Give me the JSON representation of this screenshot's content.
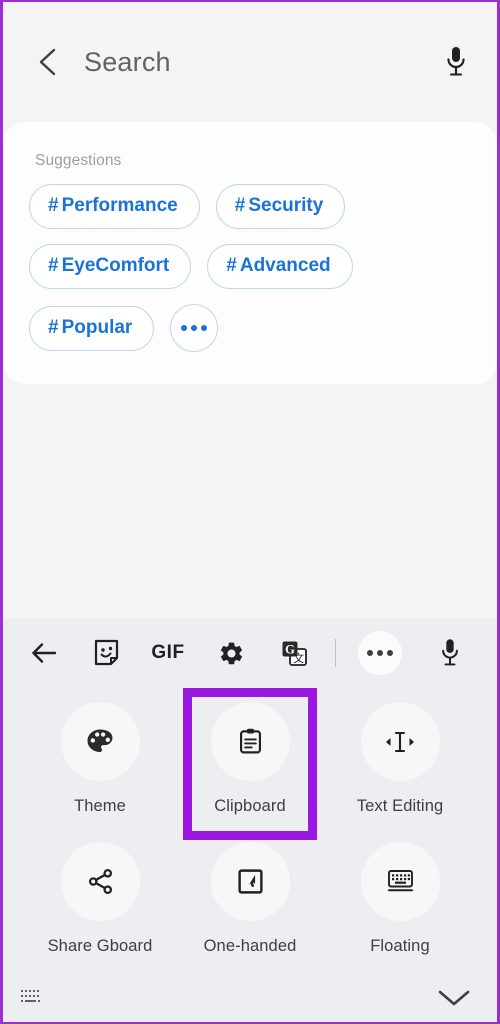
{
  "header": {
    "back_icon": "chevron-left-icon",
    "title": "Search",
    "mic_icon": "microphone-icon"
  },
  "suggestions": {
    "section_title": "Suggestions",
    "rows": [
      [
        {
          "hash": "#",
          "label": "Performance"
        },
        {
          "hash": "#",
          "label": "Security"
        }
      ],
      [
        {
          "hash": "#",
          "label": "EyeComfort"
        },
        {
          "hash": "#",
          "label": "Advanced"
        }
      ],
      [
        {
          "hash": "#",
          "label": "Popular"
        }
      ]
    ],
    "more_icon": "ellipsis-icon",
    "chip_text_color": "#1a73d8",
    "chip_border_color": "#bcd6f4"
  },
  "keyboard": {
    "toolbar": {
      "back_icon": "arrow-left-icon",
      "sticker_icon": "sticker-smiley-icon",
      "gif_label": "GIF",
      "settings_icon": "gear-icon",
      "translate_icon": "google-translate-icon",
      "more_icon": "ellipsis-icon",
      "mic_icon": "microphone-icon"
    },
    "grid": [
      {
        "icon": "palette-icon",
        "label": "Theme",
        "highlighted": false
      },
      {
        "icon": "clipboard-icon",
        "label": "Clipboard",
        "highlighted": true
      },
      {
        "icon": "text-cursor-icon",
        "label": "Text Editing",
        "highlighted": false
      },
      {
        "icon": "share-icon",
        "label": "Share Gboard",
        "highlighted": false
      },
      {
        "icon": "one-handed-icon",
        "label": "One-handed",
        "highlighted": false
      },
      {
        "icon": "keyboard-icon",
        "label": "Floating",
        "highlighted": false
      }
    ],
    "bottom": {
      "keyboard_icon": "keyboard-small-icon",
      "collapse_icon": "chevron-down-icon"
    },
    "panel_color": "#edeef1",
    "highlight_color": "#9b18e0"
  },
  "page": {
    "background_color": "#f4f4f5",
    "card_color": "#fdfdfd",
    "border_color": "#9b2fd4"
  }
}
